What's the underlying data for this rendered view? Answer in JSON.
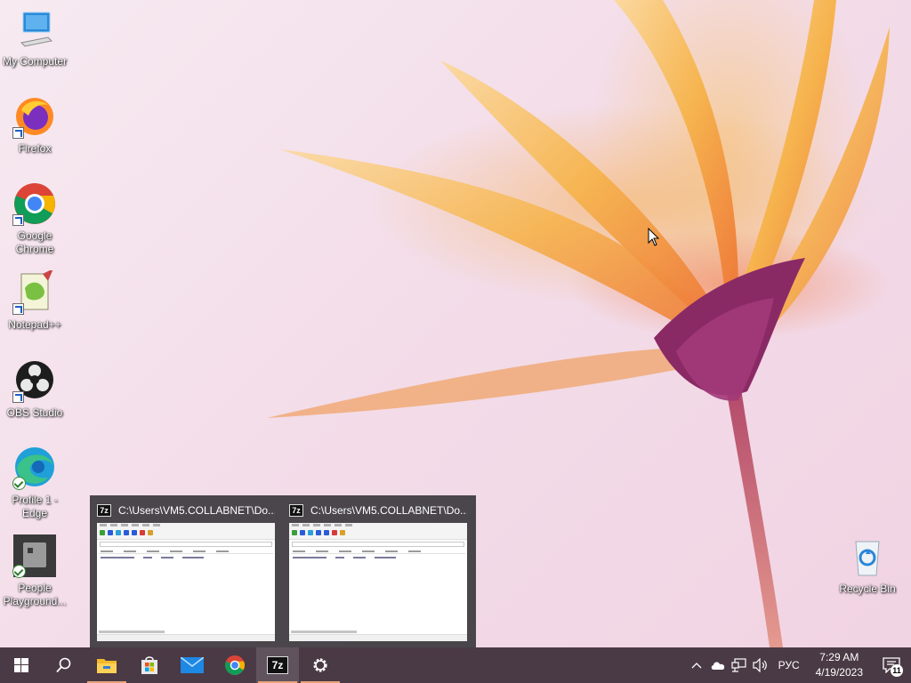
{
  "desktop": {
    "icons": [
      {
        "label": "My Computer",
        "icon": "computer-icon"
      },
      {
        "label": "Firefox",
        "icon": "firefox-icon"
      },
      {
        "label": "Google\nChrome",
        "icon": "chrome-icon"
      },
      {
        "label": "Notepad++",
        "icon": "notepadpp-icon"
      },
      {
        "label": "OBS Studio",
        "icon": "obs-icon"
      },
      {
        "label": "Profile 1 -\nEdge",
        "icon": "edge-icon"
      },
      {
        "label": "People\nPlayground...",
        "icon": "people-playground-icon"
      },
      {
        "label": "Recycle Bin",
        "icon": "recycle-bin-icon"
      }
    ]
  },
  "thumbnails": [
    {
      "title": "C:\\Users\\VM5.COLLABNET\\Do...",
      "app_icon_text": "7z"
    },
    {
      "title": "C:\\Users\\VM5.COLLABNET\\Do...",
      "app_icon_text": "7z"
    }
  ],
  "taskbar": {
    "buttons": [
      {
        "name": "start",
        "icon": "windows-logo-icon"
      },
      {
        "name": "search",
        "icon": "search-icon"
      },
      {
        "name": "file-explorer",
        "icon": "folder-icon"
      },
      {
        "name": "microsoft-store",
        "icon": "store-icon"
      },
      {
        "name": "mail",
        "icon": "mail-icon"
      },
      {
        "name": "chrome",
        "icon": "chrome-icon"
      },
      {
        "name": "7zip",
        "icon": "sevenzip-icon",
        "text": "7z"
      },
      {
        "name": "settings",
        "icon": "gear-icon"
      }
    ],
    "tray": {
      "language": "РУС",
      "time": "7:29 AM",
      "date": "4/19/2023",
      "notification_count": "11"
    }
  },
  "colors": {
    "taskbar": "#4a3a45",
    "running_indicator": "#e8a27a",
    "popup_bg": "#3c3a3e"
  }
}
